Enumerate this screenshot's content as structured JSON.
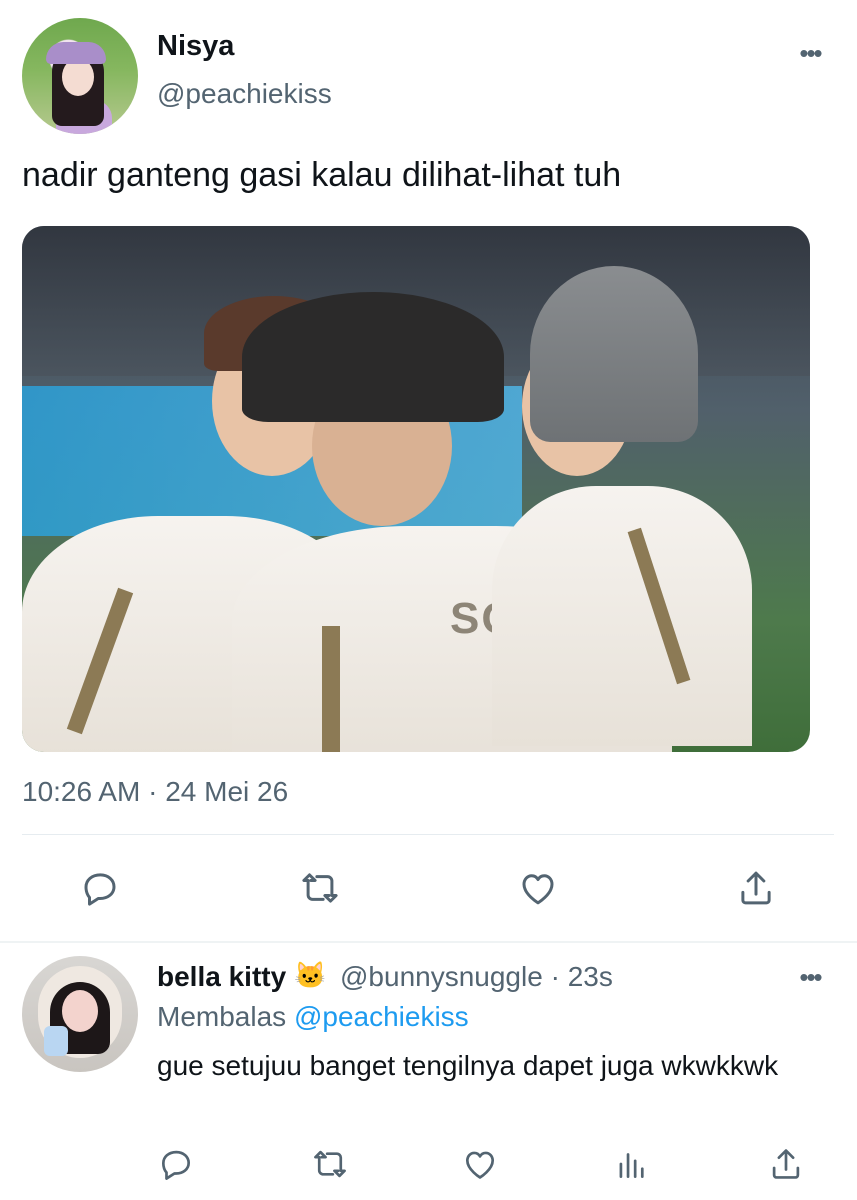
{
  "tweet": {
    "display_name": "Nisya",
    "handle": "@peachiekiss",
    "text": "nadir ganteng gasi kalau dilihat-lihat tuh",
    "time": "10:26 AM",
    "separator": "·",
    "date": "24 Mei 26",
    "media": {
      "jersey_text": "SON"
    },
    "actions": [
      "reply-icon",
      "retweet-icon",
      "like-icon",
      "share-icon"
    ]
  },
  "reply": {
    "display_name": "bella kitty",
    "emoji": "🐱",
    "handle": "@bunnysnuggle",
    "separator": "·",
    "age": "23s",
    "replying_label": "Membalas",
    "replying_mention": "@peachiekiss",
    "text": "gue setujuu banget tengilnya dapet juga wkwkkwk",
    "actions": [
      "reply-icon",
      "retweet-icon",
      "like-icon",
      "views-icon",
      "share-icon"
    ]
  },
  "colors": {
    "text": "#0f1419",
    "secondary": "#536471",
    "accent": "#1d9bf0",
    "divider": "#eff3f4"
  }
}
